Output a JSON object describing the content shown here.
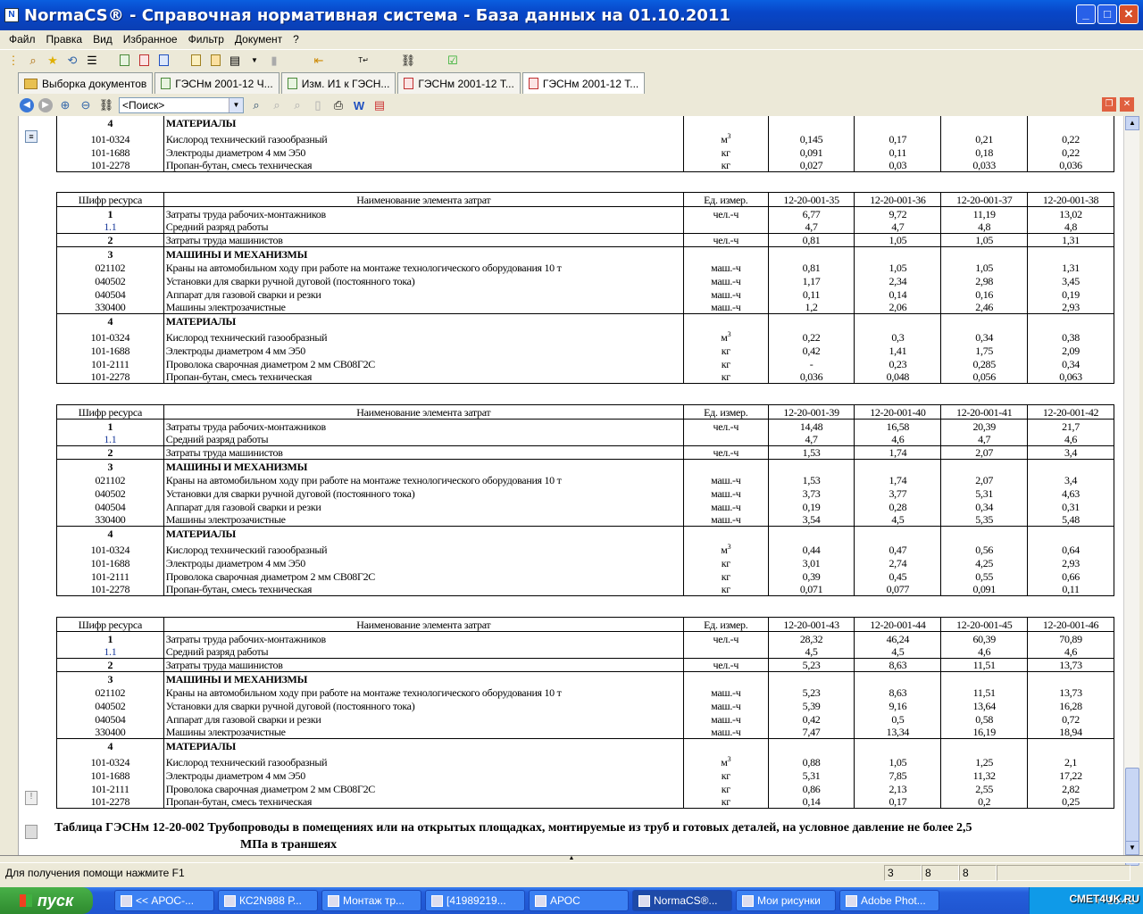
{
  "window": {
    "title": "NormaCS® - Справочная нормативная система - База данных на 01.10.2011",
    "app_icon": "N",
    "minimize": "_",
    "maximize": "□",
    "close": "✕"
  },
  "menu": [
    "Файл",
    "Правка",
    "Вид",
    "Избранное",
    "Фильтр",
    "Документ",
    "?"
  ],
  "tabs": [
    {
      "label": "Выборка документов",
      "icon": "folder"
    },
    {
      "label": "ГЭСНм 2001-12 Ч...",
      "icon": "doc-green"
    },
    {
      "label": "Изм. И1  к ГЭСН...",
      "icon": "doc-green"
    },
    {
      "label": "ГЭСНм 2001-12 Т...",
      "icon": "doc-red"
    },
    {
      "label": "ГЭСНм 2001-12 Т...",
      "icon": "doc-red",
      "active": true
    }
  ],
  "search": {
    "value": "<Поиск>"
  },
  "labels": {
    "hdr_code": "Шифр ресурса",
    "hdr_name": "Наименование элемента затрат",
    "hdr_unit": "Ед. измер.",
    "labor": "Затраты труда рабочих-монтажников",
    "grade": "Средний разряд работы",
    "machinist": "Затраты труда машинистов",
    "machines": "МАШИНЫ И МЕХАНИЗМЫ",
    "materials": "МАТЕРИАЛЫ",
    "crane": "Краны на автомобильном ходу при работе на монтаже технологического оборудования 10 т",
    "welder": "Установки для сварки ручной дуговой (постоянного тока)",
    "gas": "Аппарат для газовой сварки и резки",
    "cleaner": "Машины электрозачистные",
    "oxygen": "Кислород технический газообразный",
    "electrodes": "Электроды диаметром 4 мм Э50",
    "wire": "Проволока сварочная диаметром 2 мм СВ08Г2С",
    "propane": "Пропан-бутан, смесь техническая",
    "u_man": "чел.-ч",
    "u_mach": "маш.-ч",
    "u_kg": "кг",
    "u_m": "м",
    "u_m_sup": "3"
  },
  "partial_block": {
    "rows": [
      {
        "code": "4",
        "key": "materials",
        "values": [
          "",
          "",
          "",
          ""
        ]
      },
      {
        "code": "101-0324",
        "key": "oxygen",
        "unit": "m3",
        "values": [
          "0,145",
          "0,17",
          "0,21",
          "0,22"
        ]
      },
      {
        "code": "101-1688",
        "key": "electrodes",
        "unit": "u_kg",
        "values": [
          "0,091",
          "0,11",
          "0,18",
          "0,22"
        ]
      },
      {
        "code": "101-2278",
        "key": "propane",
        "unit": "u_kg",
        "values": [
          "0,027",
          "0,03",
          "0,033",
          "0,036"
        ]
      }
    ]
  },
  "blocks": [
    {
      "columns": [
        "12-20-001-35",
        "12-20-001-36",
        "12-20-001-37",
        "12-20-001-38"
      ],
      "labor": [
        "6,77",
        "9,72",
        "11,19",
        "13,02"
      ],
      "grade": [
        "4,7",
        "4,7",
        "4,8",
        "4,8"
      ],
      "machinist": [
        "0,81",
        "1,05",
        "1,05",
        "1,31"
      ],
      "crane": [
        "0,81",
        "1,05",
        "1,05",
        "1,31"
      ],
      "welder": [
        "1,17",
        "2,34",
        "2,98",
        "3,45"
      ],
      "gas": [
        "0,11",
        "0,14",
        "0,16",
        "0,19"
      ],
      "cleaner": [
        "1,2",
        "2,06",
        "2,46",
        "2,93"
      ],
      "oxygen": [
        "0,22",
        "0,3",
        "0,34",
        "0,38"
      ],
      "electrodes": [
        "0,42",
        "1,41",
        "1,75",
        "2,09"
      ],
      "wire": [
        "-",
        "0,23",
        "0,285",
        "0,34"
      ],
      "propane": [
        "0,036",
        "0,048",
        "0,056",
        "0,063"
      ]
    },
    {
      "columns": [
        "12-20-001-39",
        "12-20-001-40",
        "12-20-001-41",
        "12-20-001-42"
      ],
      "labor": [
        "14,48",
        "16,58",
        "20,39",
        "21,7"
      ],
      "grade": [
        "4,7",
        "4,6",
        "4,7",
        "4,6"
      ],
      "machinist": [
        "1,53",
        "1,74",
        "2,07",
        "3,4"
      ],
      "crane": [
        "1,53",
        "1,74",
        "2,07",
        "3,4"
      ],
      "welder": [
        "3,73",
        "3,77",
        "5,31",
        "4,63"
      ],
      "gas": [
        "0,19",
        "0,28",
        "0,34",
        "0,31"
      ],
      "cleaner": [
        "3,54",
        "4,5",
        "5,35",
        "5,48"
      ],
      "oxygen": [
        "0,44",
        "0,47",
        "0,56",
        "0,64"
      ],
      "electrodes": [
        "3,01",
        "2,74",
        "4,25",
        "2,93"
      ],
      "wire": [
        "0,39",
        "0,45",
        "0,55",
        "0,66"
      ],
      "propane": [
        "0,071",
        "0,077",
        "0,091",
        "0,11"
      ]
    },
    {
      "columns": [
        "12-20-001-43",
        "12-20-001-44",
        "12-20-001-45",
        "12-20-001-46"
      ],
      "labor": [
        "28,32",
        "46,24",
        "60,39",
        "70,89"
      ],
      "grade": [
        "4,5",
        "4,5",
        "4,6",
        "4,6"
      ],
      "machinist": [
        "5,23",
        "8,63",
        "11,51",
        "13,73"
      ],
      "crane": [
        "5,23",
        "8,63",
        "11,51",
        "13,73"
      ],
      "welder": [
        "5,39",
        "9,16",
        "13,64",
        "16,28"
      ],
      "gas": [
        "0,42",
        "0,5",
        "0,58",
        "0,72"
      ],
      "cleaner": [
        "7,47",
        "13,34",
        "16,19",
        "18,94"
      ],
      "oxygen": [
        "0,88",
        "1,05",
        "1,25",
        "2,1"
      ],
      "electrodes": [
        "5,31",
        "7,85",
        "11,32",
        "17,22"
      ],
      "wire": [
        "0,86",
        "2,13",
        "2,55",
        "2,82"
      ],
      "propane": [
        "0,14",
        "0,17",
        "0,2",
        "0,25"
      ]
    }
  ],
  "table_title": {
    "line1": "Таблица ГЭСНм 12-20-002 Трубопроводы в помещениях или на открытых площадках, монтируемые из труб и готовых деталей, на условное давление не более 2,5",
    "line2": "МПа в траншеях"
  },
  "status": {
    "message": "Для получения помощи нажмите F1",
    "cells": [
      "3",
      "8",
      "8",
      ""
    ]
  },
  "taskbar": {
    "start": "пуск",
    "tasks": [
      {
        "label": "<< АРОС-..."
      },
      {
        "label": "КС2N988 Р..."
      },
      {
        "label": "Монтаж тр..."
      },
      {
        "label": "[41989219..."
      },
      {
        "label": "АРОС"
      },
      {
        "label": "NormaCS®...",
        "active": true
      },
      {
        "label": "Мои рисунки"
      },
      {
        "label": "Adobe Phot..."
      }
    ],
    "clock": "16:41",
    "watermark": "СМЕТ4UK.RU"
  }
}
